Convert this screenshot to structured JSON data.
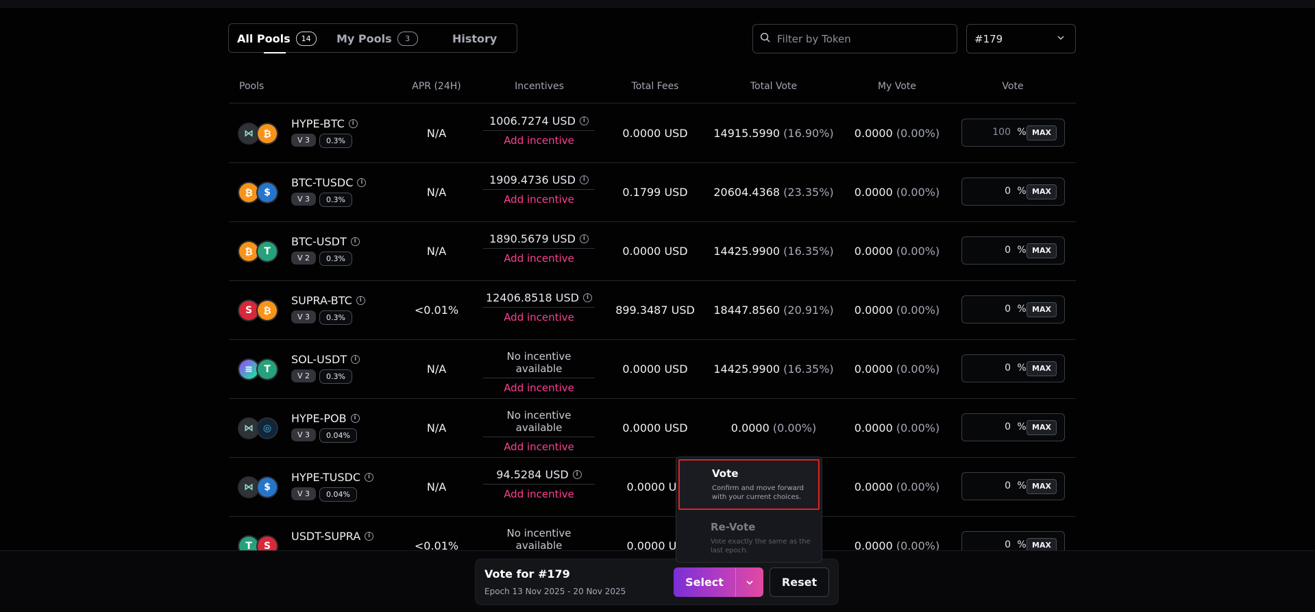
{
  "tabs": [
    {
      "label": "All Pools",
      "count": "14"
    },
    {
      "label": "My Pools",
      "count": "3"
    },
    {
      "label": "History"
    }
  ],
  "filter": {
    "placeholder": "Filter by Token",
    "icon": "search-icon"
  },
  "epoch_select": {
    "value": "#179",
    "icon": "chevron-down-icon"
  },
  "columns": [
    "Pools",
    "APR (24H)",
    "Incentives",
    "Total Fees",
    "Total Vote",
    "My Vote",
    "Vote"
  ],
  "add_incentive_label": "Add incentive",
  "max_label": "MAX",
  "percent_label": "%",
  "colors": {
    "accent_pink": "#ff3f93",
    "select_gradient_start": "#7b2fd6",
    "select_gradient_end": "#e14aa0",
    "highlight_red": "#e02424"
  },
  "pools": [
    {
      "name": "HYPE-BTC",
      "version": "V 3",
      "fee": "0.3%",
      "apr": "N/A",
      "incentive": "1006.7274 USD",
      "total_fees": "0.0000 USD",
      "total_vote": "14915.5990",
      "total_vote_pct": "(16.90%)",
      "my_vote": "0.0000",
      "my_vote_pct": "(0.00%)",
      "vote_input": "100",
      "tokens": [
        "hype",
        "btc"
      ]
    },
    {
      "name": "BTC-TUSDC",
      "version": "V 3",
      "fee": "0.3%",
      "apr": "N/A",
      "incentive": "1909.4736 USD",
      "total_fees": "0.1799 USD",
      "total_vote": "20604.4368",
      "total_vote_pct": "(23.35%)",
      "my_vote": "0.0000",
      "my_vote_pct": "(0.00%)",
      "vote_input": "0",
      "tokens": [
        "btc",
        "tusdc"
      ]
    },
    {
      "name": "BTC-USDT",
      "version": "V 2",
      "fee": "0.3%",
      "apr": "N/A",
      "incentive": "1890.5679 USD",
      "total_fees": "0.0000 USD",
      "total_vote": "14425.9900",
      "total_vote_pct": "(16.35%)",
      "my_vote": "0.0000",
      "my_vote_pct": "(0.00%)",
      "vote_input": "0",
      "tokens": [
        "btc",
        "usdt"
      ]
    },
    {
      "name": "SUPRA-BTC",
      "version": "V 3",
      "fee": "0.3%",
      "apr": "<0.01%",
      "incentive": "12406.8518 USD",
      "total_fees": "899.3487 USD",
      "total_vote": "18447.8560",
      "total_vote_pct": "(20.91%)",
      "my_vote": "0.0000",
      "my_vote_pct": "(0.00%)",
      "vote_input": "0",
      "tokens": [
        "supra",
        "btc"
      ]
    },
    {
      "name": "SOL-USDT",
      "version": "V 2",
      "fee": "0.3%",
      "apr": "N/A",
      "incentive": "No incentive available",
      "total_fees": "0.0000 USD",
      "total_vote": "14425.9900",
      "total_vote_pct": "(16.35%)",
      "my_vote": "0.0000",
      "my_vote_pct": "(0.00%)",
      "vote_input": "0",
      "tokens": [
        "sol",
        "usdt"
      ]
    },
    {
      "name": "HYPE-POB",
      "version": "V 3",
      "fee": "0.04%",
      "apr": "N/A",
      "incentive": "No incentive available",
      "total_fees": "0.0000 USD",
      "total_vote": "0.0000",
      "total_vote_pct": "(0.00%)",
      "my_vote": "0.0000",
      "my_vote_pct": "(0.00%)",
      "vote_input": "0",
      "tokens": [
        "hype",
        "pob"
      ]
    },
    {
      "name": "HYPE-TUSDC",
      "version": "V 3",
      "fee": "0.04%",
      "apr": "N/A",
      "incentive": "94.5284 USD",
      "total_fees": "0.0000 US",
      "total_vote": "",
      "total_vote_pct": "",
      "my_vote": "0.0000",
      "my_vote_pct": "(0.00%)",
      "vote_input": "0",
      "tokens": [
        "hype",
        "tusdc"
      ]
    },
    {
      "name": "USDT-SUPRA",
      "version": "",
      "fee": "",
      "apr": "<0.01%",
      "incentive": "No incentive available",
      "total_fees": "0.0000 US",
      "total_vote": "",
      "total_vote_pct": "",
      "my_vote": "0.0000",
      "my_vote_pct": "(0.00%)",
      "vote_input": "0",
      "tokens": [
        "usdt",
        "supra"
      ]
    }
  ],
  "dropdown": {
    "options": [
      {
        "title": "Vote",
        "desc": "Confirm and move forward with your current choices."
      },
      {
        "title": "Re-Vote",
        "desc": "Vote exactly the same as the last epoch."
      }
    ]
  },
  "vote_panel": {
    "title": "Vote for #179",
    "epoch": "Epoch 13 Nov 2025 - 20 Nov 2025",
    "select_label": "Select",
    "reset_label": "Reset"
  }
}
